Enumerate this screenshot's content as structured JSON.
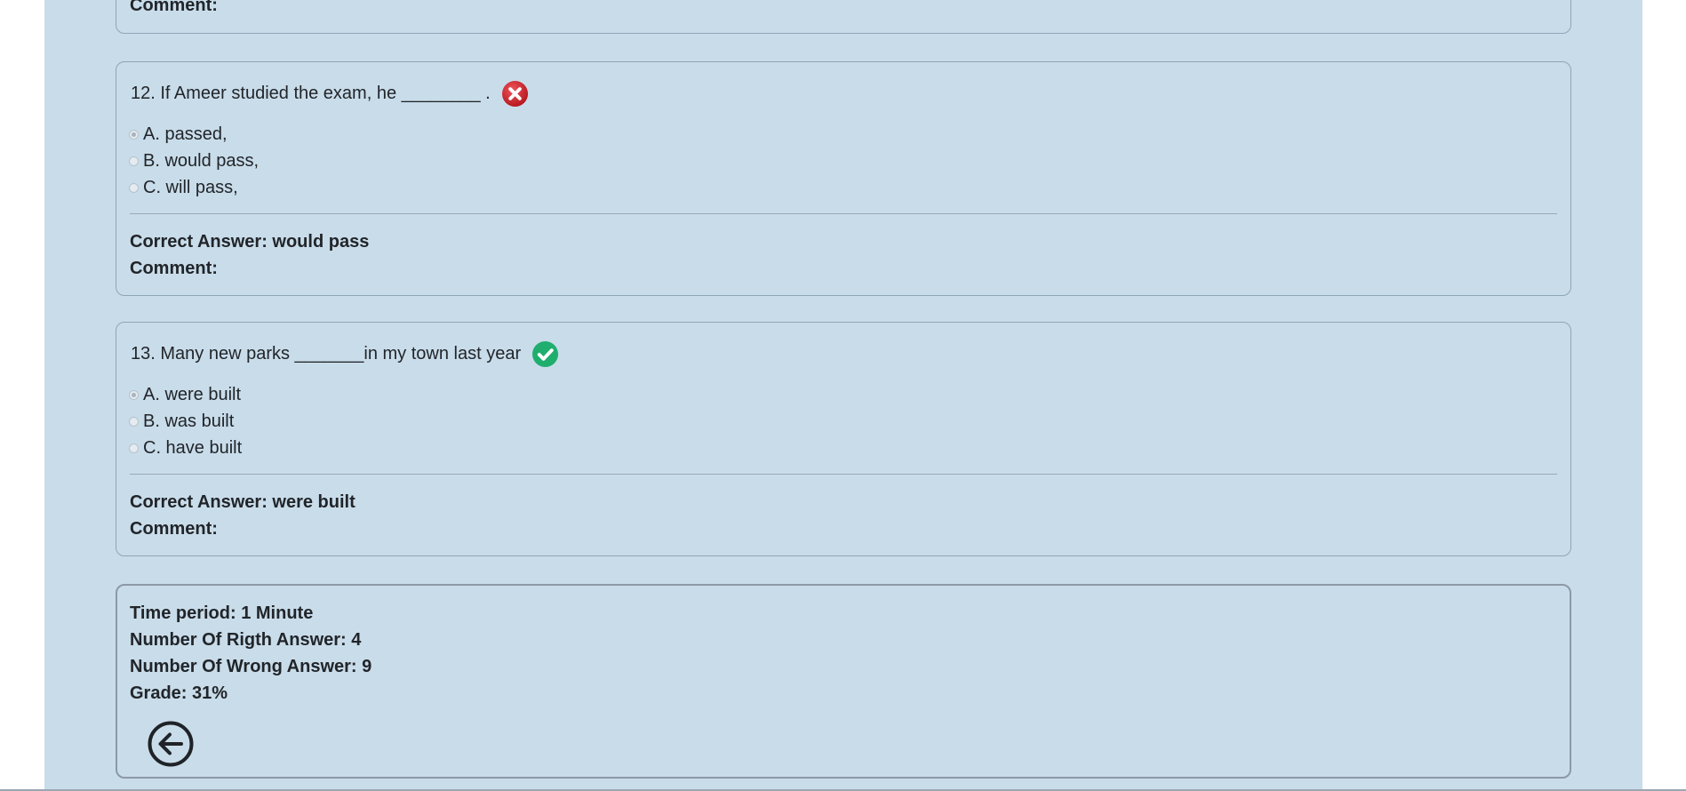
{
  "previous_card": {
    "comment_label": "Comment:"
  },
  "questions": [
    {
      "text": "12. If Ameer studied the exam, he ________ .",
      "status": "incorrect",
      "status_icon": "x-circle-icon",
      "status_color": "#d9282f",
      "options": [
        {
          "label": "A. passed,",
          "selected": true
        },
        {
          "label": "B. would pass,",
          "selected": false
        },
        {
          "label": "C. will pass,",
          "selected": false
        }
      ],
      "correct_answer": "Correct Answer: would pass",
      "comment_label": "Comment:"
    },
    {
      "text": "13. Many new parks _______in my town last year",
      "status": "correct",
      "status_icon": "check-circle-icon",
      "status_color": "#1fae6e",
      "options": [
        {
          "label": "A. were built",
          "selected": true
        },
        {
          "label": "B. was built",
          "selected": false
        },
        {
          "label": "C. have built",
          "selected": false
        }
      ],
      "correct_answer": "Correct Answer: were built",
      "comment_label": "Comment:"
    }
  ],
  "summary": {
    "time_period": "Time period: 1 Minute",
    "right_answers": "Number Of Rigth Answer: 4",
    "wrong_answers": "Number Of Wrong Answer: 9",
    "grade": "Grade: 31%",
    "back_icon": "arrow-left-circle-icon"
  },
  "colors": {
    "panel_bg": "#c9dcea",
    "border": "#8fa6b6"
  }
}
